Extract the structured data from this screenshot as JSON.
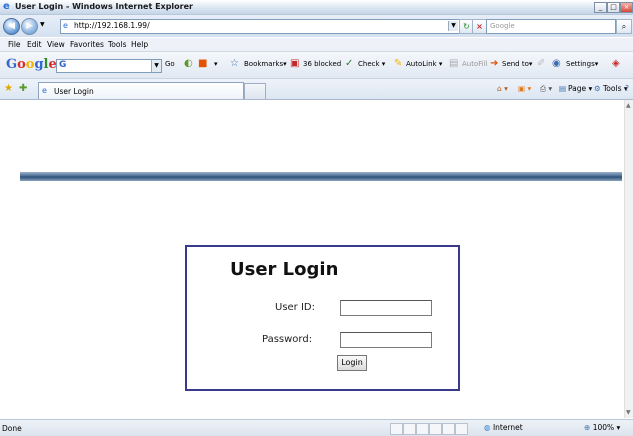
{
  "window": {
    "title": "User Login - Windows Internet Explorer",
    "controls": [
      "_",
      "□",
      "×"
    ]
  },
  "navigation": {
    "url": "http://192.168.1.99/",
    "search_placeholder": "Google"
  },
  "menu": [
    "File",
    "Edit",
    "View",
    "Favorites",
    "Tools",
    "Help"
  ],
  "google_toolbar": {
    "logo": "Google",
    "go_label": "Go",
    "items": [
      "Bookmarks▾",
      "36 blocked",
      "Check ▾",
      "AutoLink ▾",
      "AutoFill",
      "Send to▾",
      "Settings▾"
    ]
  },
  "tabs": {
    "active": "User Login"
  },
  "command_bar": {
    "page": "Page ▾",
    "tools": "Tools ▾"
  },
  "login": {
    "heading": "User Login",
    "user_id_label": "User ID:",
    "password_label": "Password:",
    "user_id_value": "",
    "password_value": "",
    "button_label": "Login"
  },
  "status": {
    "text": "Done",
    "zone": "Internet",
    "zoom": "100%"
  },
  "colors": {
    "login_border": "#3a3a8c",
    "banner": "#2c5078"
  }
}
